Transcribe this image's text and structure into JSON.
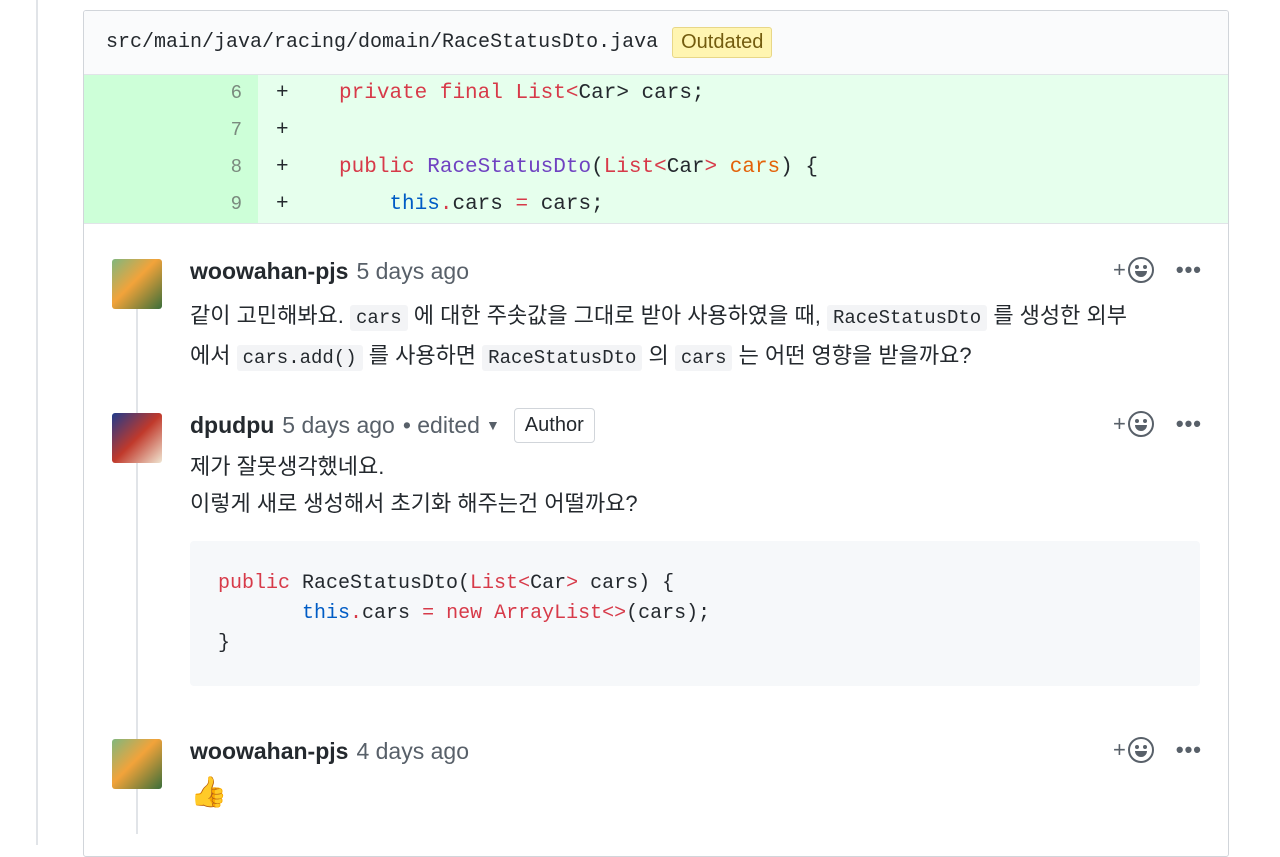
{
  "file": {
    "path": "src/main/java/racing/domain/RaceStatusDto.java",
    "badge": "Outdated"
  },
  "diff": {
    "lines": [
      {
        "num": "6",
        "sign": "+",
        "tokens": [
          "    ",
          "private final ",
          "List",
          "<",
          "Car",
          "> cars;"
        ]
      },
      {
        "num": "7",
        "sign": "+"
      },
      {
        "num": "8",
        "sign": "+",
        "tokens": [
          "    ",
          "public ",
          "RaceStatusDto",
          "(",
          "List",
          "<",
          "Car",
          "> ",
          "cars",
          ") {"
        ]
      },
      {
        "num": "9",
        "sign": "+",
        "tokens": [
          "        ",
          "this",
          ".",
          "cars ",
          "=",
          " cars;"
        ]
      }
    ]
  },
  "comments": [
    {
      "author": "woowahan-pjs",
      "time": "5 days ago",
      "body": {
        "l1_a": "같이 고민해봐요. ",
        "code1": "cars",
        "l1_b": " 에 대한 주솟값을 그대로 받아 사용하였을 때, ",
        "code2": "RaceStatusDto",
        "l1_c": " 를 생성한 외부",
        "l2_a": "에서 ",
        "code3": "cars.add()",
        "l2_b": " 를 사용하면 ",
        "code4": "RaceStatusDto",
        "l2_c": " 의 ",
        "code5": "cars",
        "l2_d": " 는 어떤 영향을 받을까요?"
      },
      "react": "+",
      "more": "•••"
    },
    {
      "author": "dpudpu",
      "time": "5 days ago",
      "edited": "• edited",
      "badge": "Author",
      "lines": [
        "제가 잘못생각했네요.",
        "이렇게 새로 생성해서 초기화 해주는건 어떨까요?"
      ],
      "code": {
        "l1": [
          "public ",
          "RaceStatusDto(",
          "List",
          "<",
          "Car",
          "> cars) {"
        ],
        "l2": [
          "this",
          ".cars ",
          "= new ",
          "ArrayList",
          "<>",
          "(cars);"
        ],
        "l3": "}"
      },
      "react": "+",
      "more": "•••"
    },
    {
      "author": "woowahan-pjs",
      "time": "4 days ago",
      "emoji": "👍",
      "react": "+",
      "more": "•••"
    }
  ]
}
